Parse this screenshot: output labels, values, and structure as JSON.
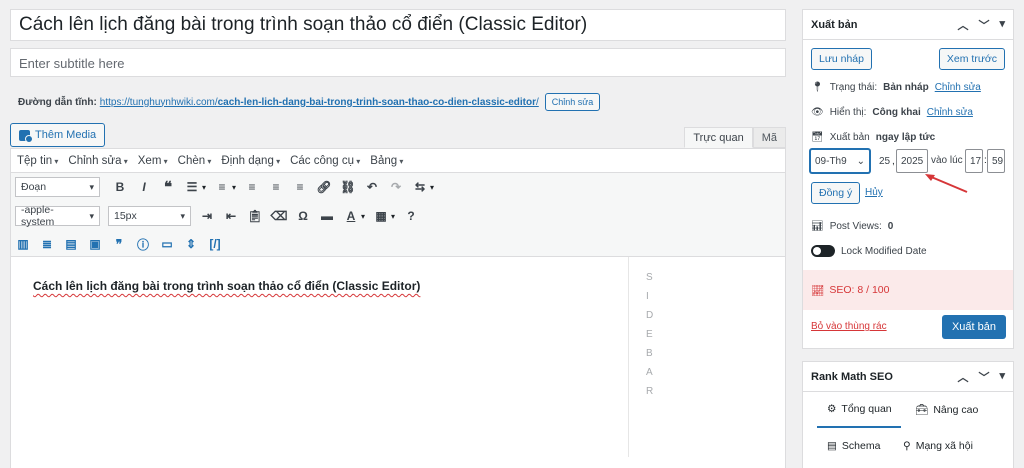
{
  "post": {
    "title": "Cách lên lịch đăng bài trong trình soạn thảo cổ điển (Classic Editor)",
    "subtitle_placeholder": "Enter subtitle here",
    "permalink_label": "Đường dẫn tĩnh:",
    "permalink_base": "https://tunghuynhwiki.com/",
    "permalink_slug": "cach-len-lich-dang-bai-trong-trinh-soan-thao-co-dien-classic-editor",
    "permalink_trailing": "/",
    "edit_permalink": "Chỉnh sửa"
  },
  "editor": {
    "add_media": "Thêm Media",
    "tab_visual": "Trực quan",
    "tab_text": "Mã",
    "menus": [
      "Tệp tin",
      "Chỉnh sửa",
      "Xem",
      "Chèn",
      "Định dạng",
      "Các công cụ",
      "Bảng"
    ],
    "format_select": "Đoạn",
    "font_select": "-apple-system",
    "size_select": "15px",
    "content": "Cách lên lịch đăng bài trong trình soạn thảo cổ điển (Classic Editor)",
    "sidebar_letters": [
      "S",
      "I",
      "D",
      "E",
      "B",
      "A",
      "R"
    ]
  },
  "publish": {
    "title": "Xuất bản",
    "save_draft": "Lưu nháp",
    "preview": "Xem trước",
    "status_label": "Trạng thái:",
    "status_value": "Bản nháp",
    "visibility_label": "Hiển thị:",
    "visibility_value": "Công khai",
    "edit": "Chỉnh sửa",
    "schedule_label": "Xuất bản",
    "schedule_value": "ngay lập tức",
    "month": "09-Th9",
    "day": "25",
    "year": "2025",
    "at": "vào lúc",
    "hour": "17",
    "minute": "59",
    "ok": "Đồng ý",
    "cancel": "Hủy",
    "post_views": "Post Views:",
    "post_views_count": "0",
    "lock_modified": "Lock Modified Date",
    "seo_score": "SEO: 8 / 100",
    "trash": "Bỏ vào thùng rác",
    "publish_button": "Xuất bản"
  },
  "rankmath": {
    "title": "Rank Math SEO",
    "tabs": [
      "Tổng quan",
      "Nâng cao",
      "Schema",
      "Mạng xã hội"
    ]
  },
  "colors": {
    "accent": "#2271b1",
    "danger": "#d63638"
  }
}
